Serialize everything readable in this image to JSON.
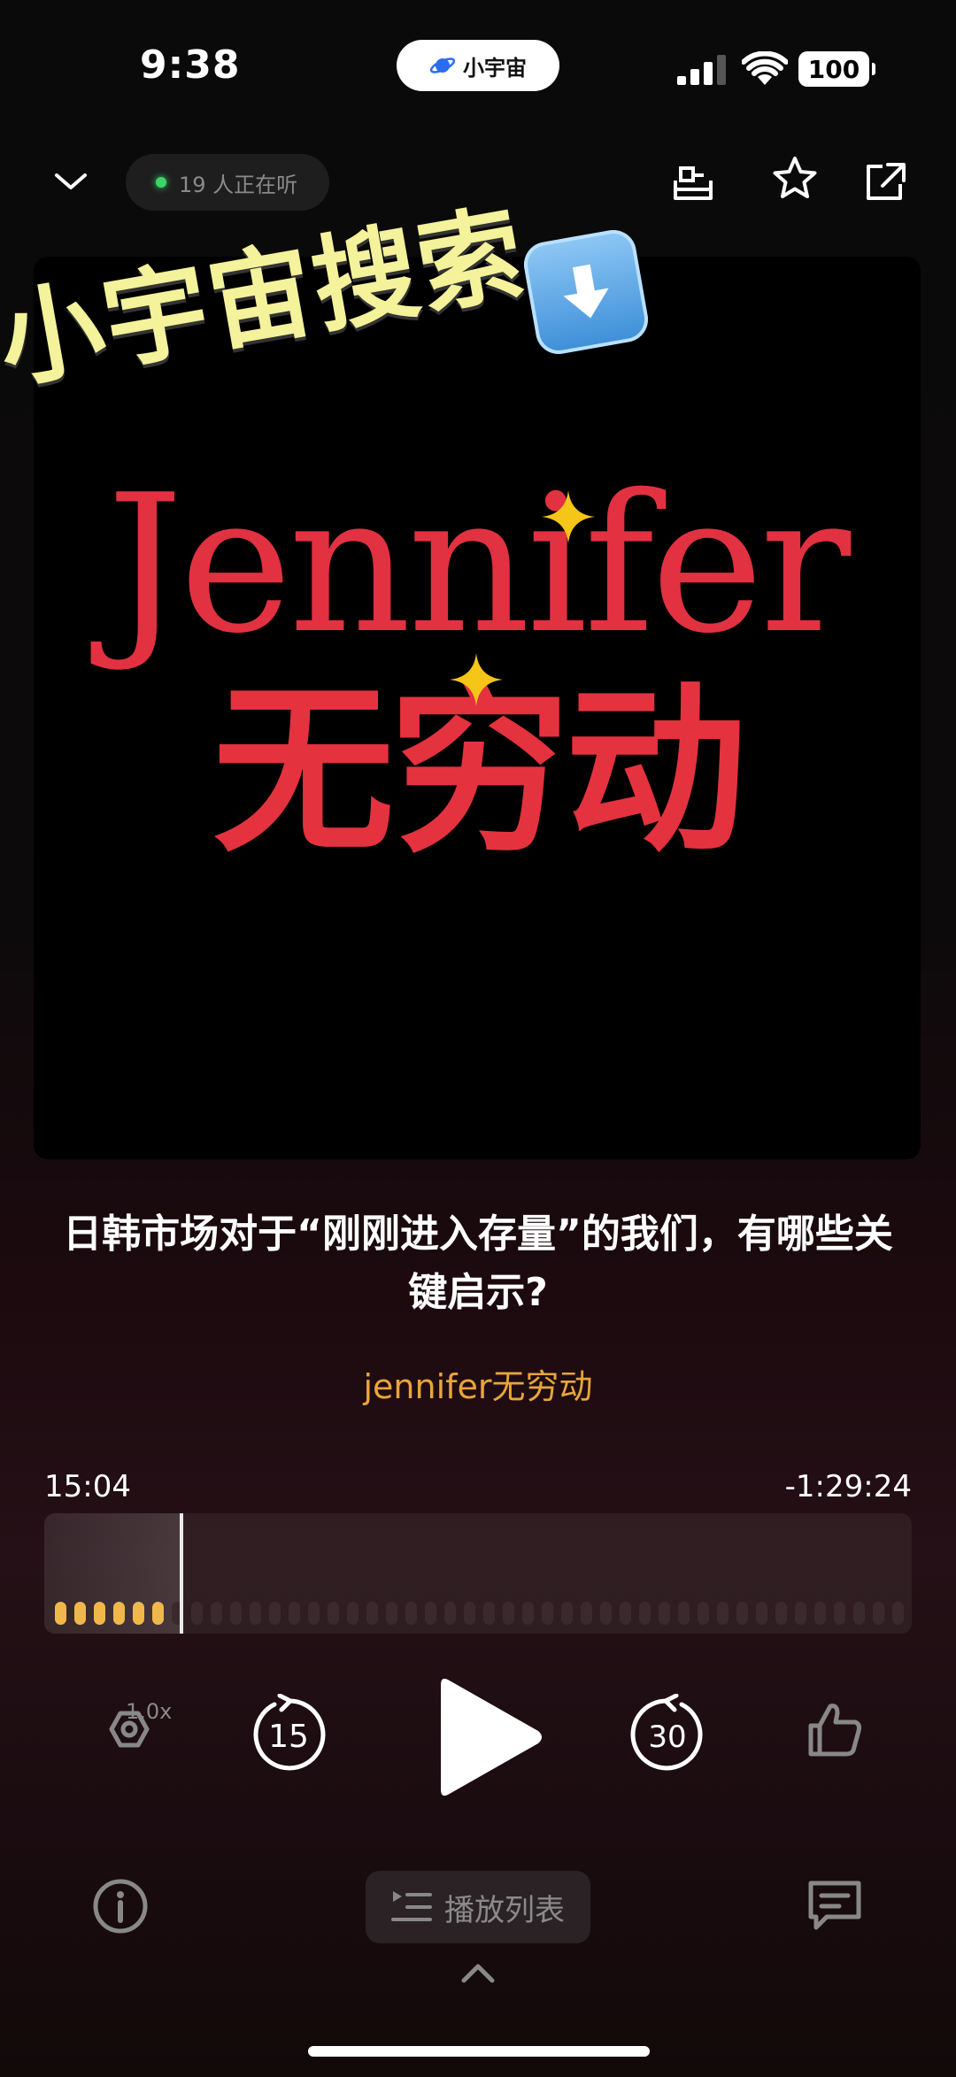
{
  "status_bar": {
    "time": "9:38",
    "app_name": "小宇宙",
    "battery": "100"
  },
  "header": {
    "listeners": "19 人正在听"
  },
  "cover": {
    "overlay_text": "小宇宙搜索",
    "title_en": "Jennifer",
    "title_cn": "无穷动",
    "title_color": "#e23141",
    "overlay_color": "#f4f29a"
  },
  "episode": {
    "title": "日韩市场对于“刚刚进入存量”的我们，有哪些关键启示?",
    "author": "jennifer无穷动"
  },
  "progress": {
    "elapsed": "15:04",
    "remaining": "-1:29:24",
    "played_fraction": 0.145
  },
  "controls": {
    "speed": "1.0x",
    "rewind_seconds": "15",
    "forward_seconds": "30",
    "playlist_label": "播放列表"
  },
  "icons": [
    "chevron-down-icon",
    "tray-icon",
    "star-icon",
    "share-icon",
    "speed-icon",
    "rewind-15-icon",
    "play-icon",
    "forward-30-icon",
    "thumbs-up-icon",
    "info-icon",
    "playlist-icon",
    "comment-icon",
    "chevron-up-icon"
  ]
}
